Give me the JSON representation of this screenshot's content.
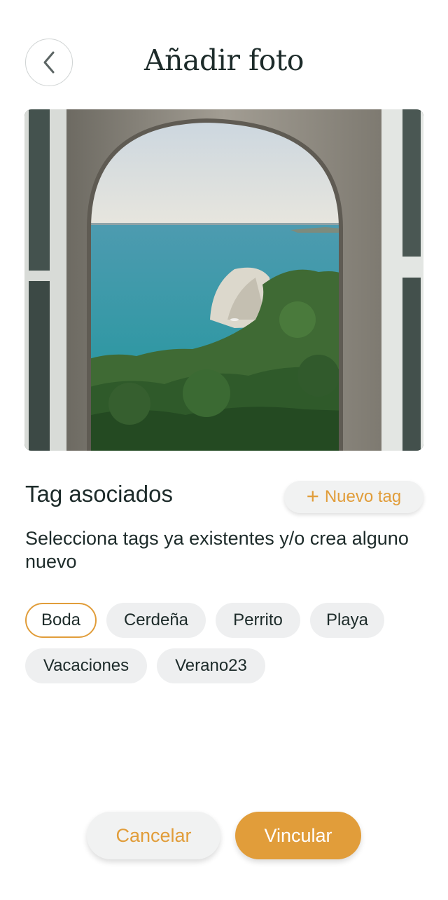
{
  "header": {
    "title": "Añadir foto",
    "back_icon": "chevron-left-icon"
  },
  "photo": {
    "subject": "sea view through stone arched window"
  },
  "tags_section": {
    "title": "Tag asociados",
    "new_tag_label": "Nuevo tag",
    "new_tag_icon": "plus-icon",
    "description": "Selecciona tags ya existentes y/o crea alguno nuevo",
    "tags": [
      {
        "label": "Boda",
        "selected": true
      },
      {
        "label": "Cerdeña",
        "selected": false
      },
      {
        "label": "Perrito",
        "selected": false
      },
      {
        "label": "Playa",
        "selected": false
      },
      {
        "label": "Vacaciones",
        "selected": false
      },
      {
        "label": "Verano23",
        "selected": false
      }
    ]
  },
  "actions": {
    "cancel_label": "Cancelar",
    "confirm_label": "Vincular"
  },
  "colors": {
    "accent": "#e19d3a",
    "text": "#1d2b2a",
    "chip_bg": "#eeeff0"
  }
}
